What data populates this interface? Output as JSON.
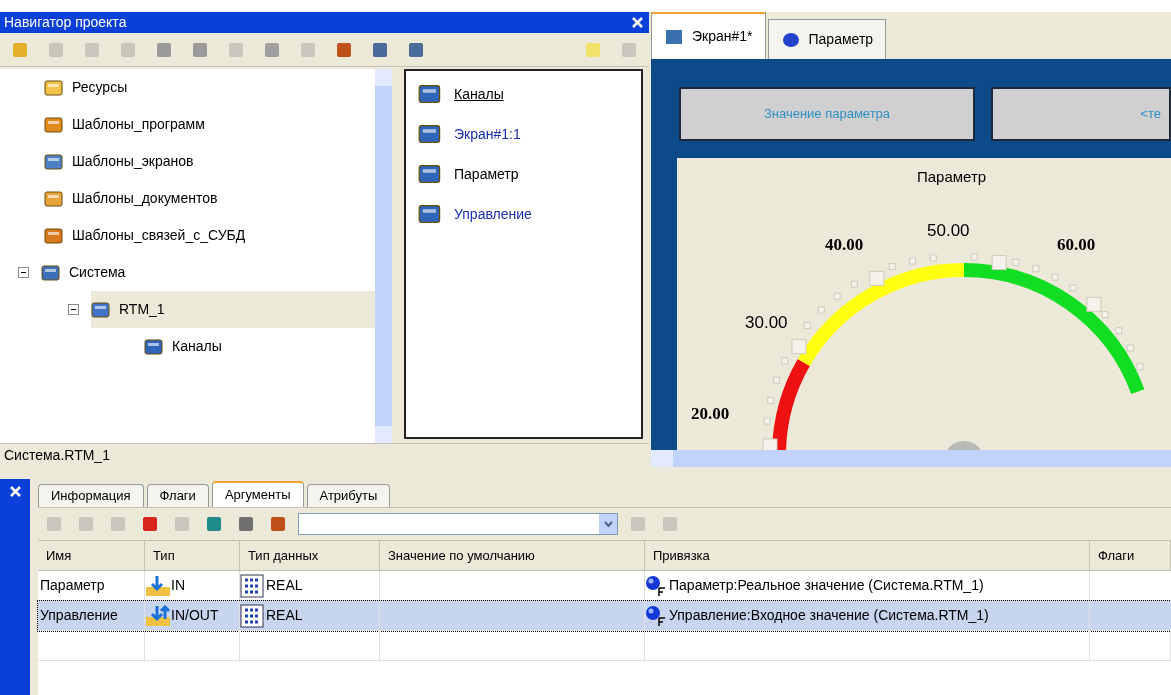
{
  "navigator": {
    "title": "Навигатор проекта",
    "tree": [
      {
        "label": "Ресурсы",
        "kind": "folder",
        "selected": false
      },
      {
        "label": "Шаблоны_программ",
        "kind": "program",
        "selected": false
      },
      {
        "label": "Шаблоны_экранов",
        "kind": "screen",
        "selected": false
      },
      {
        "label": "Шаблоны_документов",
        "kind": "docs",
        "selected": false
      },
      {
        "label": "Шаблоны_связей_с_СУБД",
        "kind": "db",
        "selected": false
      },
      {
        "label": "Система",
        "kind": "system",
        "selected": false,
        "expanded": true,
        "children": [
          {
            "label": "RTM_1",
            "kind": "rtm",
            "selected": true,
            "expanded": true,
            "children": [
              {
                "label": "Каналы",
                "kind": "channels",
                "selected": false
              }
            ]
          }
        ]
      }
    ],
    "list": [
      {
        "label": "Каналы",
        "kind": "link"
      },
      {
        "label": "Экран#1:1",
        "kind": "blue"
      },
      {
        "label": "Параметр",
        "kind": "plain"
      },
      {
        "label": "Управление",
        "kind": "blue"
      }
    ],
    "status_path": "Система.RTM_1"
  },
  "editor": {
    "tabs": [
      {
        "label": "Экран#1*",
        "selected": true
      },
      {
        "label": "Параметр",
        "selected": false
      }
    ],
    "buttons": [
      "Значение параметра",
      "<те"
    ],
    "gauge": {
      "title": "Параметр",
      "scale_labels": [
        {
          "text": "20.00",
          "bold": true
        },
        {
          "text": "30.00",
          "bold": false
        },
        {
          "text": "40.00",
          "bold": true
        },
        {
          "text": "50.00",
          "bold": false
        },
        {
          "text": "60.00",
          "bold": true
        }
      ]
    }
  },
  "properties": {
    "tabs": [
      {
        "label": "Информация",
        "selected": false
      },
      {
        "label": "Флаги",
        "selected": false
      },
      {
        "label": "Аргументы",
        "selected": true
      },
      {
        "label": "Атрибуты",
        "selected": false
      }
    ],
    "columns": [
      "Имя",
      "Тип",
      "Тип данных",
      "Значение по умолчанию",
      "Привязка",
      "Флаги"
    ],
    "rows": [
      {
        "name": "Параметр",
        "type": "IN",
        "kind": "in",
        "data_type": "REAL",
        "binding": "Параметр:Реальное значение (Система.RTM_1)",
        "selected": false
      },
      {
        "name": "Управление",
        "type": "IN/OUT",
        "kind": "inout",
        "data_type": "REAL",
        "binding": "Управление:Входное значение (Система.RTM_1)",
        "selected": true
      }
    ]
  }
}
